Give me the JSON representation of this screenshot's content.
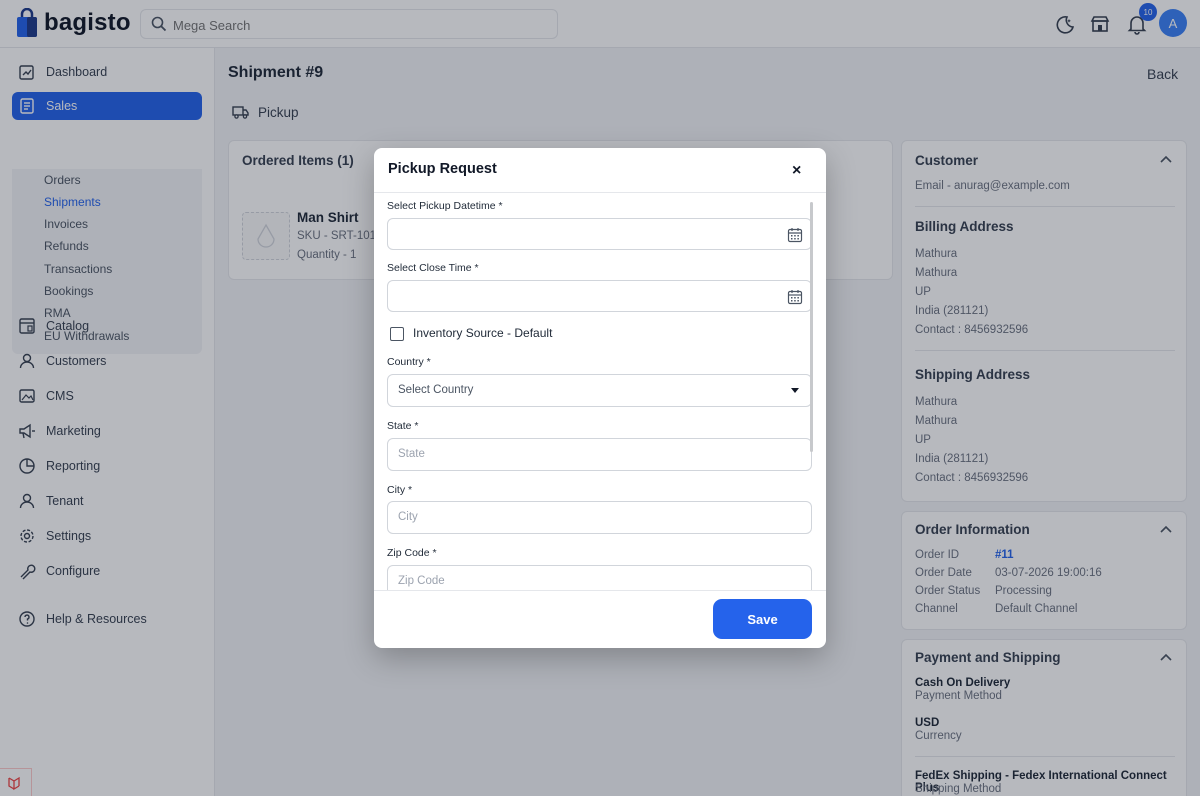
{
  "app": {
    "brand": "bagisto",
    "search_placeholder": "Mega Search",
    "notification_count": "10",
    "avatar_letter": "A"
  },
  "sidebar": {
    "items": [
      {
        "label": "Dashboard",
        "icon": "dashboard-icon"
      },
      {
        "label": "Sales",
        "icon": "sales-icon"
      },
      {
        "label": "Catalog",
        "icon": "catalog-icon"
      },
      {
        "label": "Customers",
        "icon": "customers-icon"
      },
      {
        "label": "CMS",
        "icon": "cms-icon"
      },
      {
        "label": "Marketing",
        "icon": "marketing-icon"
      },
      {
        "label": "Reporting",
        "icon": "reporting-icon"
      },
      {
        "label": "Tenant",
        "icon": "tenant-icon"
      },
      {
        "label": "Settings",
        "icon": "settings-icon"
      },
      {
        "label": "Configure",
        "icon": "configure-icon"
      },
      {
        "label": "Help & Resources",
        "icon": "help-icon"
      }
    ],
    "sales_sub": [
      "Orders",
      "Shipments",
      "Invoices",
      "Refunds",
      "Transactions",
      "Bookings",
      "RMA",
      "EU Withdrawals"
    ],
    "active_item": "Sales",
    "active_sub": "Shipments"
  },
  "page": {
    "title": "Shipment #9",
    "back": "Back",
    "pickup": "Pickup"
  },
  "ordered_items": {
    "title": "Ordered Items (1)",
    "product": {
      "name": "Man Shirt",
      "sku": "SKU - SRT-101",
      "quantity": "Quantity - 1"
    }
  },
  "customer": {
    "title": "Customer",
    "email": "Email - anurag@example.com",
    "billing_title": "Billing Address",
    "billing": [
      "Mathura",
      "Mathura",
      "UP",
      "India (281121)",
      "Contact : 8456932596"
    ],
    "shipping_title": "Shipping Address",
    "shipping": [
      "Mathura",
      "Mathura",
      "UP",
      "India (281121)",
      "Contact : 8456932596"
    ]
  },
  "order_info": {
    "title": "Order Information",
    "rows": [
      {
        "label": "Order ID",
        "value": "#11"
      },
      {
        "label": "Order Date",
        "value": "03-07-2026 19:00:16"
      },
      {
        "label": "Order Status",
        "value": "Processing"
      },
      {
        "label": "Channel",
        "value": "Default Channel"
      }
    ]
  },
  "payment": {
    "title": "Payment and Shipping",
    "method": "Cash On Delivery",
    "method_label": "Payment Method",
    "currency": "USD",
    "currency_label": "Currency",
    "shipping": "FedEx Shipping - Fedex International Connect Plus",
    "shipping_label": "Shipping Method"
  },
  "modal": {
    "title": "Pickup Request",
    "close": "×",
    "pickup_datetime_label": "Select Pickup Datetime *",
    "close_time_label": "Select Close Time *",
    "inventory_label": "Inventory Source - Default",
    "country_label": "Country *",
    "country_value": "Select Country",
    "state_label": "State *",
    "state_placeholder": "State",
    "city_label": "City *",
    "city_placeholder": "City",
    "zip_label": "Zip Code *",
    "zip_placeholder": "Zip Code",
    "save": "Save"
  },
  "colors": {
    "primary": "#2563eb",
    "overlay": "rgba(17,24,39,0.30)"
  }
}
